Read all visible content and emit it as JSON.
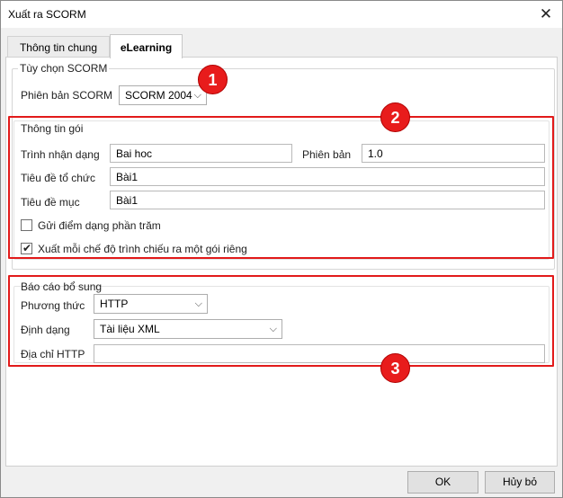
{
  "window": {
    "title": "Xuất ra SCORM"
  },
  "tabs": [
    {
      "label": "Thông tin chung",
      "active": false
    },
    {
      "label": "eLearning",
      "active": true
    }
  ],
  "scorm_options": {
    "group_title": "Tùy chọn SCORM",
    "version_label": "Phiên bản SCORM",
    "version_value": "SCORM 2004"
  },
  "package_info": {
    "group_title": "Thông tin gói",
    "identifier_label": "Trình nhận dạng",
    "identifier_value": "Bai hoc",
    "version_label": "Phiên bản",
    "version_value": "1.0",
    "org_title_label": "Tiêu đề tổ chức",
    "org_title_value": "Bài1",
    "item_title_label": "Tiêu đề mục",
    "item_title_value": "Bài1",
    "percent_score_label": "Gửi điểm dạng phần trăm",
    "percent_score_checked": false,
    "separate_package_label": "Xuất mỗi chế độ trình chiếu ra một gói riêng",
    "separate_package_checked": true
  },
  "extra_report": {
    "group_title": "Báo cáo bổ sung",
    "method_label": "Phương thức",
    "method_value": "HTTP",
    "format_label": "Định dạng",
    "format_value": "Tài liệu XML",
    "http_address_label": "Địa chỉ HTTP",
    "http_address_value": ""
  },
  "callouts": [
    "1",
    "2",
    "3"
  ],
  "buttons": {
    "ok": "OK",
    "cancel": "Hủy bỏ"
  },
  "colors": {
    "callout_red": "#e21a1a",
    "window_bg": "#f0f0f0"
  }
}
